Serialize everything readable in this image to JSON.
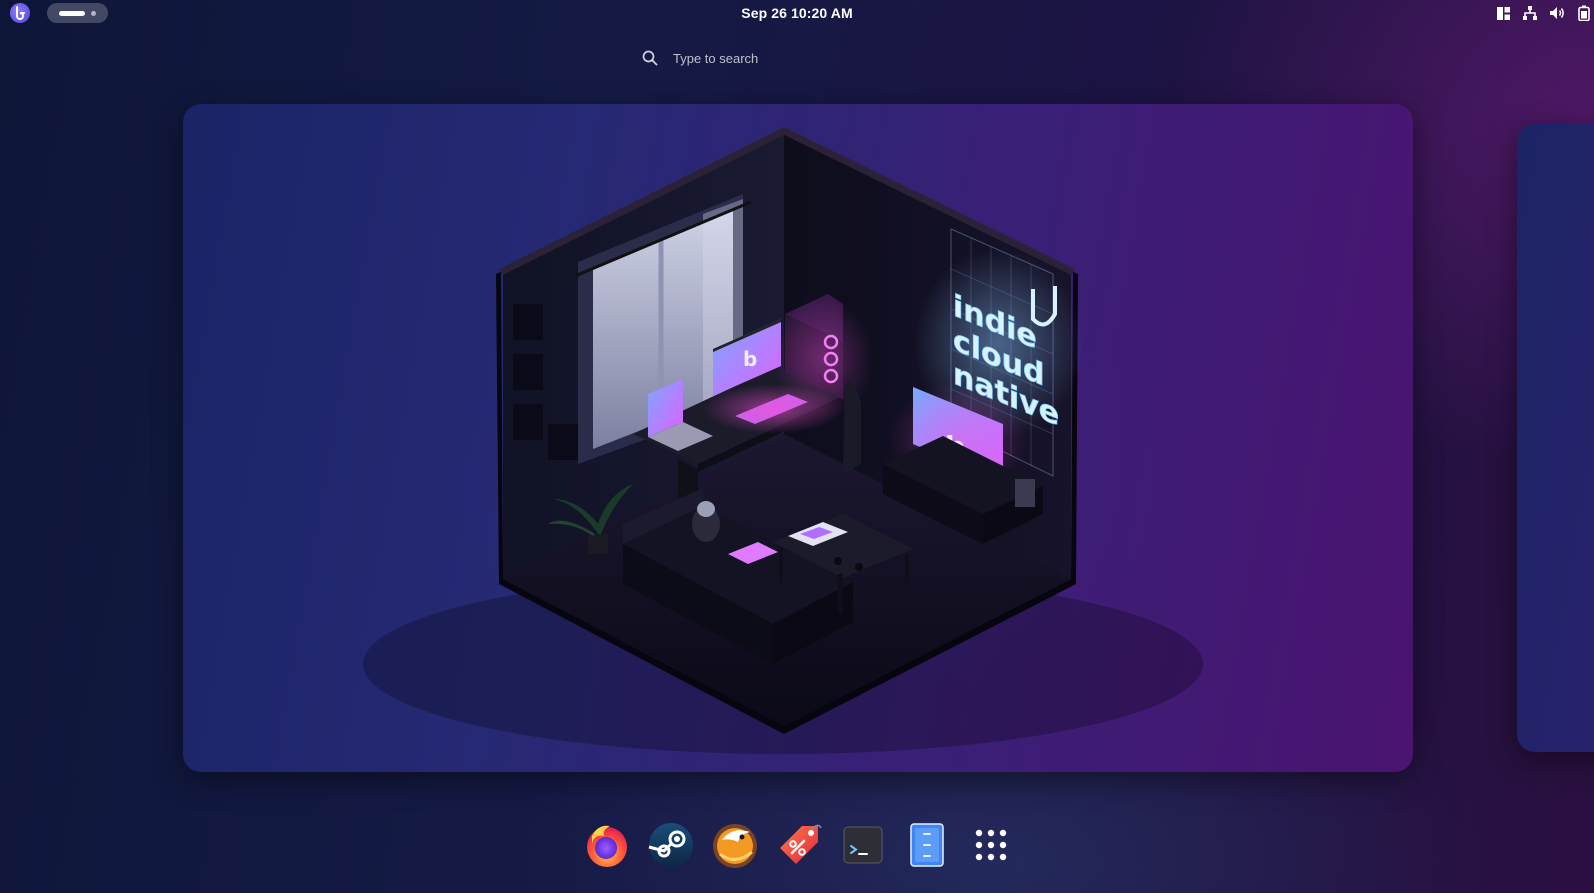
{
  "top_bar": {
    "activities_icon": "activities-logo-icon",
    "workspace_indicator": {
      "active": 1,
      "count": 2
    },
    "clock": "Sep 26  10:20 AM",
    "tray_icons": [
      "window-layout-icon",
      "network-icon",
      "volume-icon",
      "battery-icon"
    ]
  },
  "search": {
    "icon": "search-icon",
    "placeholder": "Type to search"
  },
  "workspace": {
    "wallpaper_sign": [
      "indie",
      "cloud",
      "native"
    ]
  },
  "dock": {
    "apps": [
      {
        "name": "Firefox",
        "icon": "firefox-icon"
      },
      {
        "name": "Steam",
        "icon": "steam-icon"
      },
      {
        "name": "Lutris",
        "icon": "lutris-icon"
      },
      {
        "name": "Deals",
        "icon": "price-tag-icon"
      },
      {
        "name": "Terminal",
        "icon": "terminal-icon"
      },
      {
        "name": "Files",
        "icon": "file-manager-icon"
      },
      {
        "name": "Show Apps",
        "icon": "app-grid-icon"
      }
    ]
  },
  "colors": {
    "background_start": "#0e1638",
    "background_end": "#2a1040",
    "neon_blue": "#9fe0ff",
    "neon_pink": "#ff4fd8",
    "accent": "#6a52e6"
  }
}
